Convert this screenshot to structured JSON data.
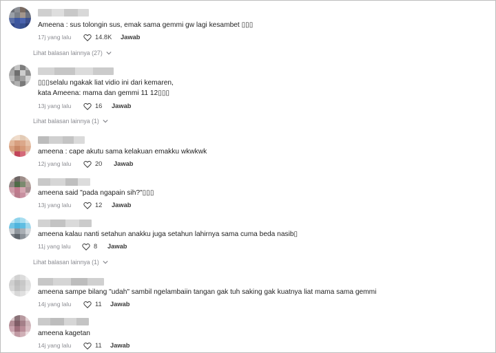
{
  "comments": [
    {
      "text": "Ameena : sus tolongin sus, emak sama gemmi gw lagi kesambet ▯▯▯",
      "time": "17j yang lalu",
      "likes": "14.8K",
      "reply_label": "Jawab",
      "more_replies": "Lihat balasan lainnya (27)"
    },
    {
      "text_line1": "▯▯▯selalu ngakak liat vidio ini dari kemaren,",
      "text_line2": "kata Ameena: mama dan gemmi 11 12▯▯▯",
      "time": "13j yang lalu",
      "likes": "16",
      "reply_label": "Jawab",
      "more_replies": "Lihat balasan lainnya (1)"
    },
    {
      "text": "ameena : cape akutu sama kelakuan emakku wkwkwk",
      "time": "12j yang lalu",
      "likes": "20",
      "reply_label": "Jawab"
    },
    {
      "text": "ameena said \"pada ngapain sih?\"▯▯▯",
      "time": "13j yang lalu",
      "likes": "12",
      "reply_label": "Jawab"
    },
    {
      "text": "ameena kalau nanti setahun anakku juga setahun lahirnya sama cuma beda nasib▯",
      "time": "11j yang lalu",
      "likes": "8",
      "reply_label": "Jawab",
      "more_replies": "Lihat balasan lainnya (1)"
    },
    {
      "text": "ameena sampe bilang \"udah\" sambil ngelambaiin tangan gak tuh saking gak kuatnya liat mama sama gemmi",
      "time": "14j yang lalu",
      "likes": "11",
      "reply_label": "Jawab"
    },
    {
      "text": "ameena kagetan",
      "time": "14j yang lalu",
      "likes": "11",
      "reply_label": "Jawab"
    }
  ],
  "icons": {
    "like": "heart-outline-icon",
    "expand": "chevron-down-icon"
  },
  "colors": {
    "text": "#1f1f1f",
    "muted": "#8a8b91",
    "border": "#bdbdbd"
  }
}
